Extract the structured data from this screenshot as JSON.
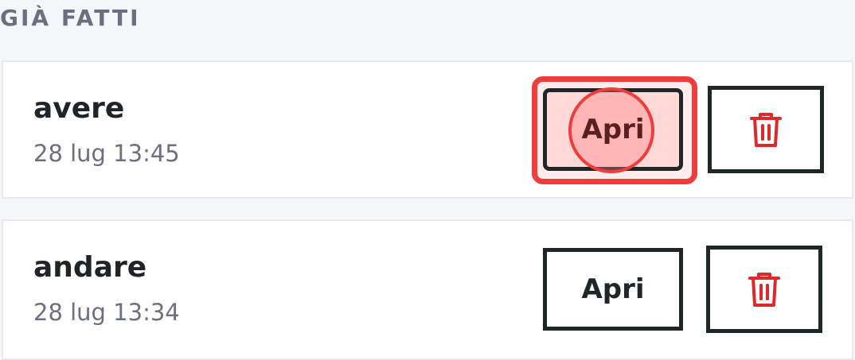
{
  "section": {
    "title": "GIÀ FATTI"
  },
  "items": [
    {
      "word": "avere",
      "timestamp": "28 lug 13:45",
      "open_label": "Apri",
      "highlighted": true
    },
    {
      "word": "andare",
      "timestamp": "28 lug 13:34",
      "open_label": "Apri",
      "highlighted": false
    }
  ],
  "icons": {
    "delete": "trash-icon"
  },
  "colors": {
    "highlight": "#f03c3c",
    "delete_icon": "#e0282a",
    "button_border": "#1e2628"
  }
}
